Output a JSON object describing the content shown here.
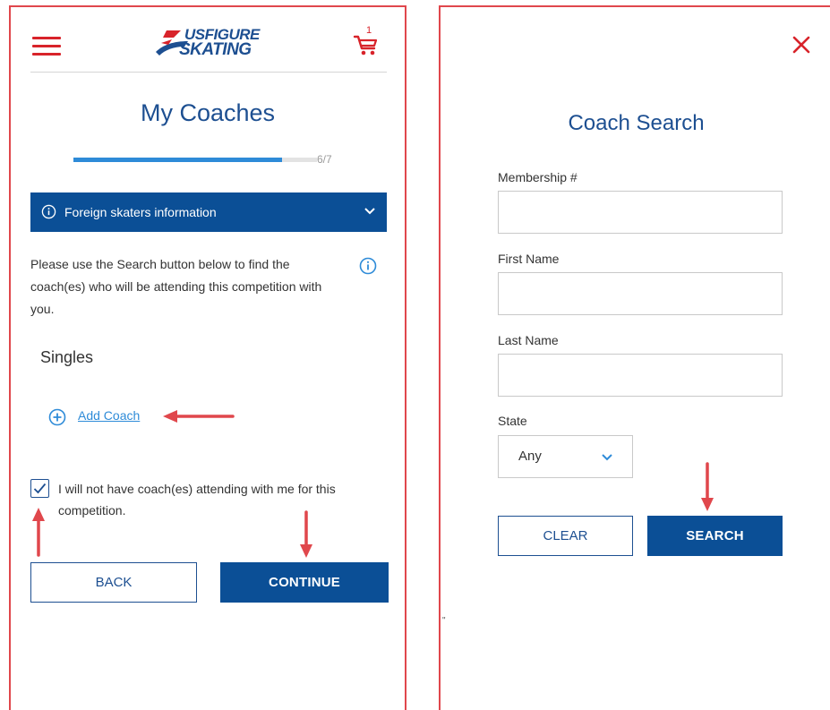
{
  "colors": {
    "brand_blue": "#0b4f96",
    "accent_light_blue": "#2e8bd8",
    "brand_red": "#d8232a",
    "annotation_red": "#e0474c"
  },
  "left_panel": {
    "header": {
      "menu_icon": "hamburger-menu-icon",
      "logo": {
        "line1": "USFIGURE",
        "line2": "SKATING"
      },
      "cart_icon": "shopping-cart-icon",
      "cart_count": "1"
    },
    "title": "My Coaches",
    "progress": {
      "label": "6/7",
      "fraction": 0.857
    },
    "banner": {
      "label": "Foreign skaters information",
      "icon": "info-circle-icon",
      "chevron": "chevron-down-icon"
    },
    "instructions": "Please use the Search button below to find the coach(es) who will be attending this competition with you.",
    "info_icon": "info-circle-icon",
    "section_title": "Singles",
    "add_coach_label": "Add Coach",
    "no_coach_checkbox": {
      "checked": true,
      "label": "I will not have coach(es) attending with me for this competition."
    },
    "back_label": "BACK",
    "continue_label": "CONTINUE"
  },
  "right_panel": {
    "close_icon": "close-x-icon",
    "title": "Coach Search",
    "fields": {
      "membership_label": "Membership #",
      "membership_value": "",
      "first_name_label": "First Name",
      "first_name_value": "",
      "last_name_label": "Last Name",
      "last_name_value": ""
    },
    "state": {
      "label": "State",
      "value": "Any"
    },
    "clear_label": "CLEAR",
    "search_label": "SEARCH",
    "stray_mark": "\""
  }
}
